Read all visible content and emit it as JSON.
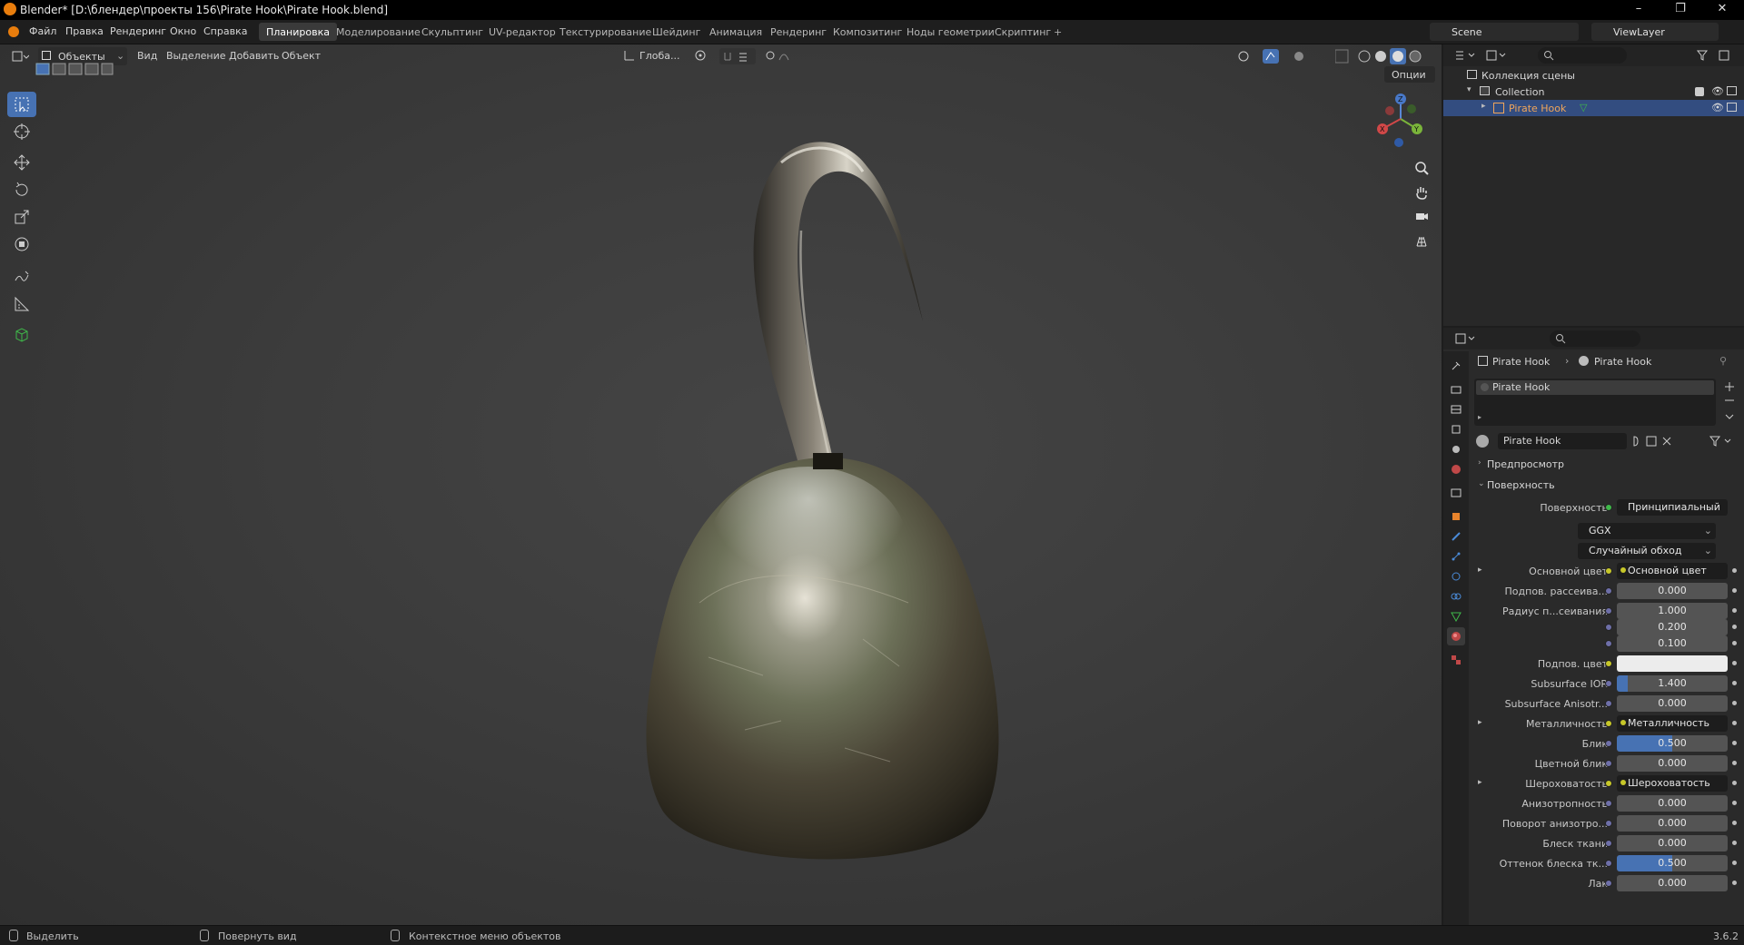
{
  "titlebar": {
    "title": "Blender* [D:\\блендер\\проекты 156\\Pirate Hook\\Pirate Hook.blend]",
    "minimize": "–",
    "maximize": "❐",
    "close": "✕"
  },
  "menu": {
    "items": [
      "Файл",
      "Правка",
      "Рендеринг",
      "Окно",
      "Справка"
    ]
  },
  "workspaces": {
    "tabs": [
      "Планировка",
      "Моделирование",
      "Скульптинг",
      "UV-редактор",
      "Текстурирование",
      "Шейдинг",
      "Анимация",
      "Рендеринг",
      "Композитинг",
      "Ноды геометрии",
      "Скриптинг"
    ],
    "add": "+"
  },
  "scene": {
    "label": "Scene",
    "viewlayer": "ViewLayer"
  },
  "viewport": {
    "mode": "Объекты",
    "menus": [
      "Вид",
      "Выделение",
      "Добавить",
      "Объект"
    ],
    "orientation": "Глоба...",
    "options": "Опции",
    "gizmo": {
      "x": "X",
      "y": "Y",
      "z": "Z"
    }
  },
  "outliner": {
    "scene_collection": "Коллекция сцены",
    "collection": "Collection",
    "object": "Pirate Hook"
  },
  "properties": {
    "breadcrumb_object": "Pirate Hook",
    "breadcrumb_material": "Pirate Hook",
    "slot_name": "Pirate Hook",
    "material_name": "Pirate Hook",
    "panels": {
      "preview": "Предпросмотр",
      "surface": "Поверхность"
    },
    "surface_label": "Поверхность",
    "surface_value": "Принципиальный BSDF",
    "distribution": "GGX",
    "subsurface_method": "Случайный обход",
    "rows": [
      {
        "label": "Основной цвет",
        "value": "Основной цвет",
        "kind": "link",
        "expand": true
      },
      {
        "label": "Подпов. рассеива...",
        "value": "0.000",
        "kind": "num"
      },
      {
        "label": "Радиус п...сеивания",
        "value": "1.000",
        "kind": "num"
      },
      {
        "label": "",
        "value": "0.200",
        "kind": "num"
      },
      {
        "label": "",
        "value": "0.100",
        "kind": "num"
      },
      {
        "label": "Подпов. цвет",
        "value": "",
        "kind": "color"
      },
      {
        "label": "Subsurface IOR",
        "value": "1.400",
        "kind": "slider",
        "fill": 0.1
      },
      {
        "label": "Subsurface Anisotr...",
        "value": "0.000",
        "kind": "num"
      },
      {
        "label": "Металличность",
        "value": "Металличность",
        "kind": "link",
        "expand": true
      },
      {
        "label": "Блик",
        "value": "0.500",
        "kind": "slider",
        "fill": 0.5
      },
      {
        "label": "Цветной блик",
        "value": "0.000",
        "kind": "num"
      },
      {
        "label": "Шероховатость",
        "value": "Шероховатость",
        "kind": "link",
        "expand": true
      },
      {
        "label": "Анизотропность",
        "value": "0.000",
        "kind": "num"
      },
      {
        "label": "Поворот анизотро...",
        "value": "0.000",
        "kind": "num"
      },
      {
        "label": "Блеск ткани",
        "value": "0.000",
        "kind": "num"
      },
      {
        "label": "Оттенок блеска тк...",
        "value": "0.500",
        "kind": "slider",
        "fill": 0.5
      },
      {
        "label": "Лак",
        "value": "0.000",
        "kind": "num"
      }
    ]
  },
  "statusbar": {
    "select": "Выделить",
    "rotate": "Повернуть вид",
    "context": "Контекстное меню объектов",
    "version": "3.6.2"
  },
  "colors": {
    "accent": "#4772b3",
    "highlight": "#334d80",
    "object_name": "#f0a55a"
  }
}
